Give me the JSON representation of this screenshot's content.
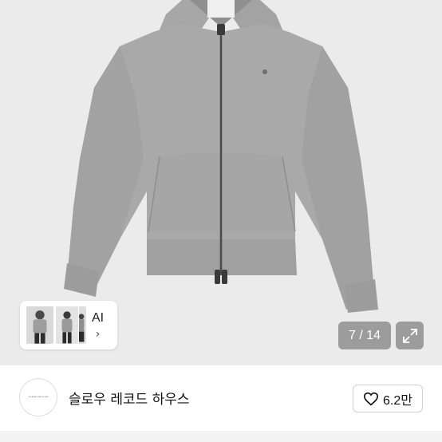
{
  "viewer": {
    "image_subject": "gray zip-up hoodie product photo",
    "page_current": "7",
    "page_total": "14",
    "page_counter": "7 / 14",
    "ai_card": {
      "label": "AI",
      "chevron": "›"
    },
    "expand_icon": "expand-arrows-icon"
  },
  "shop": {
    "name": "슬로우 레코드 하우스",
    "logo_text": "SLOW RECORD HOUSE",
    "like_icon": "heart-outline-icon",
    "like_count": "6.2만"
  },
  "colors": {
    "viewer_bg": "#ebebeb",
    "hoodie": "#a9a9a9",
    "overlay": "rgba(60,60,60,0.45)",
    "border": "#d0d0d0"
  }
}
